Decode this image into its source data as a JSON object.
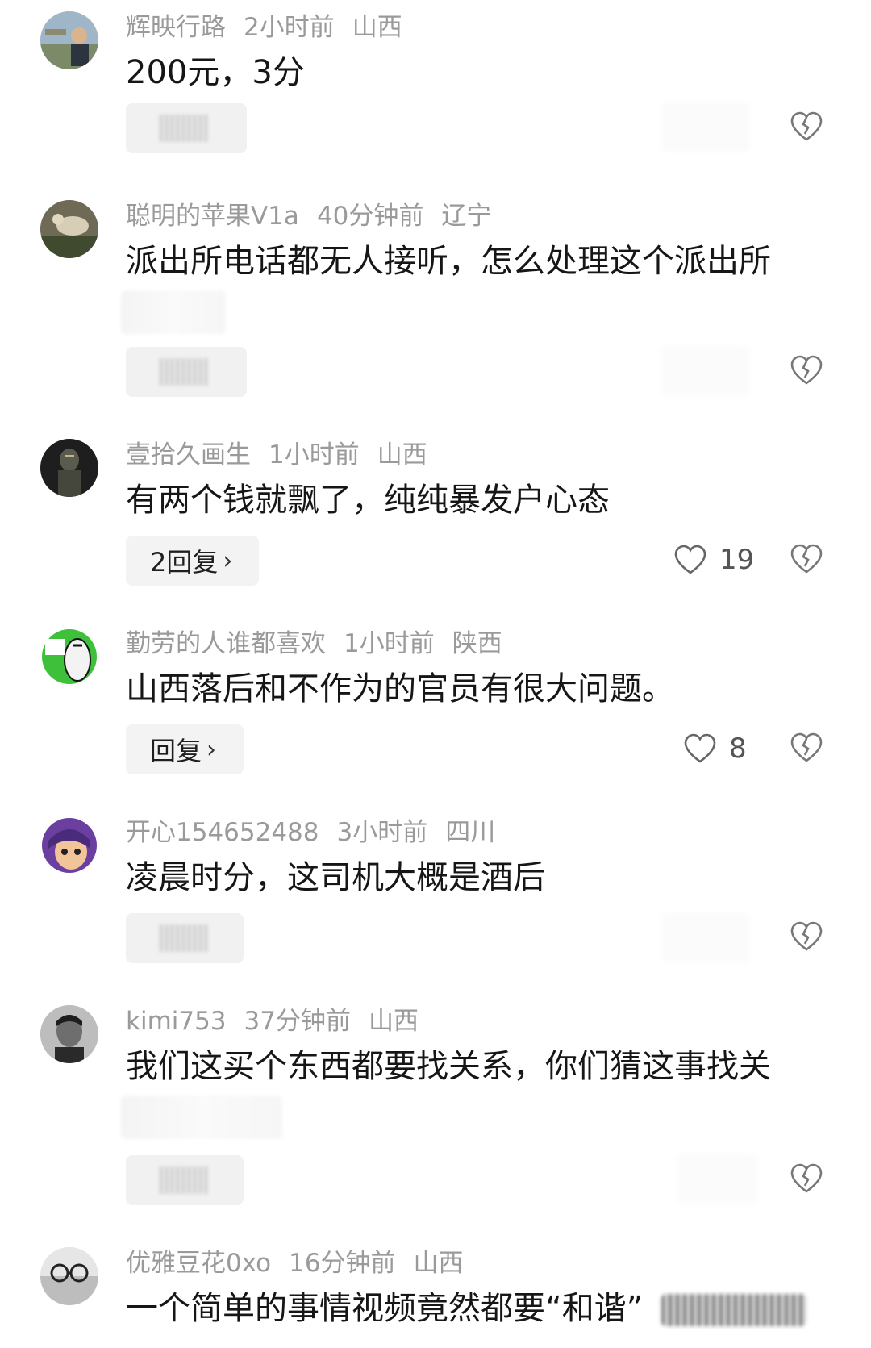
{
  "comments": [
    {
      "user": "辉映行路",
      "time": "2小时前",
      "location": "山西",
      "text": "200元，3分",
      "reply": null,
      "likes": null
    },
    {
      "user": "聪明的苹果V1a",
      "time": "40分钟前",
      "location": "辽宁",
      "text": "派出所电话都无人接听，怎么处理这个派出所",
      "reply": null,
      "likes": null
    },
    {
      "user": "壹拾久画生",
      "time": "1小时前",
      "location": "山西",
      "text": "有两个钱就飘了，纯纯暴发户心态",
      "reply": "2回复",
      "likes": "19"
    },
    {
      "user": "勤劳的人谁都喜欢",
      "time": "1小时前",
      "location": "陕西",
      "text": "山西落后和不作为的官员有很大问题。",
      "reply": "回复",
      "likes": "8"
    },
    {
      "user": "开心154652488",
      "time": "3小时前",
      "location": "四川",
      "text": "凌晨时分，这司机大概是酒后",
      "reply": null,
      "likes": null
    },
    {
      "user": "kimi753",
      "time": "37分钟前",
      "location": "山西",
      "text": "我们这买个东西都要找关系，你们猜这事找关",
      "reply": null,
      "likes": null
    },
    {
      "user": "优雅豆花0xo",
      "time": "16分钟前",
      "location": "山西",
      "text": "一个简单的事情视频竟然都要“和谐”",
      "reply": null,
      "likes": null
    }
  ],
  "icons": {
    "like": "heart-outline-icon",
    "dislike": "broken-heart-icon",
    "reply_chevron": "chevron-right-icon"
  },
  "colors": {
    "meta": "#9a9a9a",
    "text": "#161616",
    "pill_bg": "#f3f3f3"
  }
}
